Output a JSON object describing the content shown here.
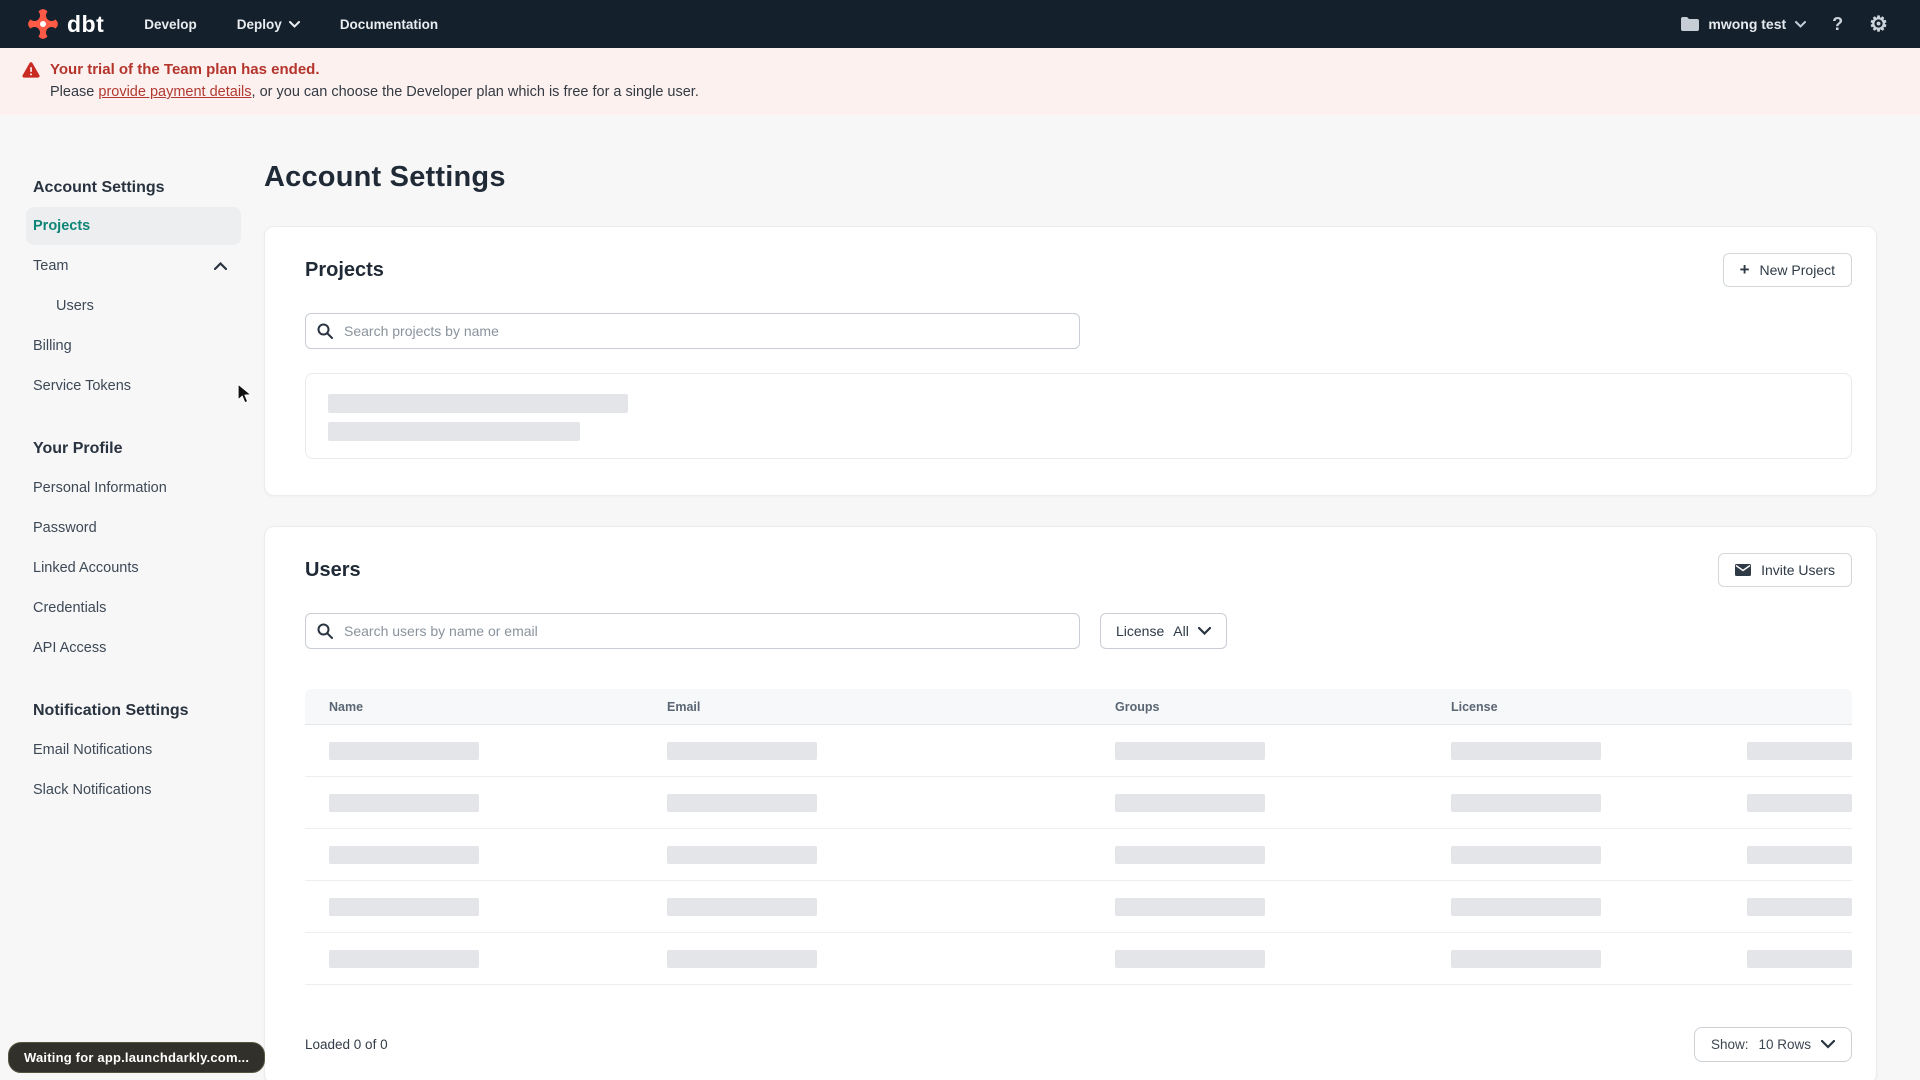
{
  "colors": {
    "nav_bg": "#14202c",
    "brand_orange": "#ff5a45",
    "banner_bg": "#fdf1f0",
    "banner_red": "#b4352c",
    "active_teal": "#0f8578",
    "page_bg": "#f7f7f8",
    "skeleton_gray": "#e3e5e8"
  },
  "nav": {
    "logo_text": "dbt",
    "menu": [
      {
        "label": "Develop"
      },
      {
        "label": "Deploy"
      },
      {
        "label": "Documentation"
      }
    ],
    "account_label": "mwong test",
    "help_glyph": "?",
    "gear_glyph": "⚙"
  },
  "banner": {
    "title": "Your trial of the Team plan has ended.",
    "body_prefix": "Please ",
    "link_text": "provide payment details",
    "body_suffix": ", or you can choose the Developer plan which is free for a single user."
  },
  "sidebar": {
    "sections": [
      {
        "heading": "Account Settings",
        "items": [
          {
            "label": "Projects"
          },
          {
            "label": "Team"
          },
          {
            "label": "Users"
          },
          {
            "label": "Billing"
          },
          {
            "label": "Service Tokens"
          }
        ]
      },
      {
        "heading": "Your Profile",
        "items": [
          {
            "label": "Personal Information"
          },
          {
            "label": "Password"
          },
          {
            "label": "Linked Accounts"
          },
          {
            "label": "Credentials"
          },
          {
            "label": "API Access"
          }
        ]
      },
      {
        "heading": "Notification Settings",
        "items": [
          {
            "label": "Email Notifications"
          },
          {
            "label": "Slack Notifications"
          }
        ]
      }
    ]
  },
  "main": {
    "page_title": "Account Settings",
    "projects": {
      "title": "Projects",
      "plus_glyph": "+",
      "new_project_label": "New Project",
      "search_placeholder": "Search projects by name"
    },
    "users": {
      "title": "Users",
      "invite_label": "Invite Users",
      "search_placeholder": "Search users by name or email",
      "license_label": "License",
      "license_value": "All",
      "table_columns": [
        "Name",
        "Email",
        "Groups",
        "License"
      ],
      "loaded_text": "Loaded 0 of 0",
      "show_label": "Show:",
      "show_value": "10 Rows"
    }
  },
  "browser_status": "Waiting for app.launchdarkly.com..."
}
